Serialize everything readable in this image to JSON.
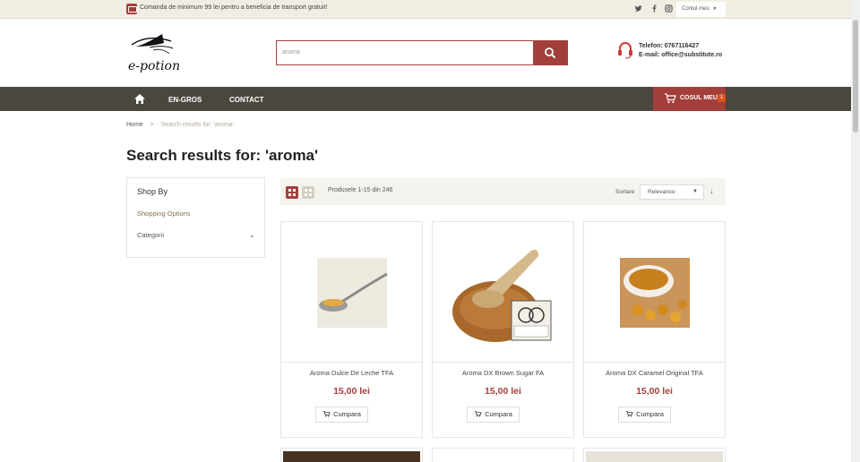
{
  "topbar": {
    "promo": "Comanda de minimum 99 lei pentru a beneficia de transport gratuit!",
    "social": [
      "twitter-icon",
      "facebook-icon",
      "instagram-icon"
    ],
    "account_label": "Contul meu"
  },
  "header": {
    "logo_text": "e-potion",
    "search": {
      "value": "aroma"
    },
    "contact_phone": "Telefon: 0767116427",
    "contact_email": "E-mail: office@substitute.ro"
  },
  "nav": {
    "items": [
      {
        "label": "EN-GROS"
      },
      {
        "label": "CONTACT"
      }
    ],
    "cart_label": "COSUL MEU",
    "cart_count": "1"
  },
  "breadcrumb": {
    "home": "Home",
    "separator": ">",
    "current": "Search results for: 'aroma'"
  },
  "page_title": "Search results for: 'aroma'",
  "sidebar": {
    "title": "Shop By",
    "subtitle": "Shopping Options",
    "filter_label": "Categorii"
  },
  "toolbar": {
    "count_text": "Produsele 1-15 din 246",
    "sort_label": "Sortare",
    "sort_value": "Relevance"
  },
  "products": [
    {
      "name": "Aroma Dulce De Leche TFA",
      "price": "15,00 lei",
      "button": "Cumpara"
    },
    {
      "name": "Aroma DX Brown Sugar FA",
      "price": "15,00 lei",
      "button": "Cumpara"
    },
    {
      "name": "Aroma DX Caramel Original TFA",
      "price": "15,00 lei",
      "button": "Cumpara"
    }
  ],
  "colors": {
    "accent": "#a33f3a",
    "nav_bg": "#4b463e",
    "topbar_bg": "#f1ede3",
    "badge": "#e0521d"
  }
}
